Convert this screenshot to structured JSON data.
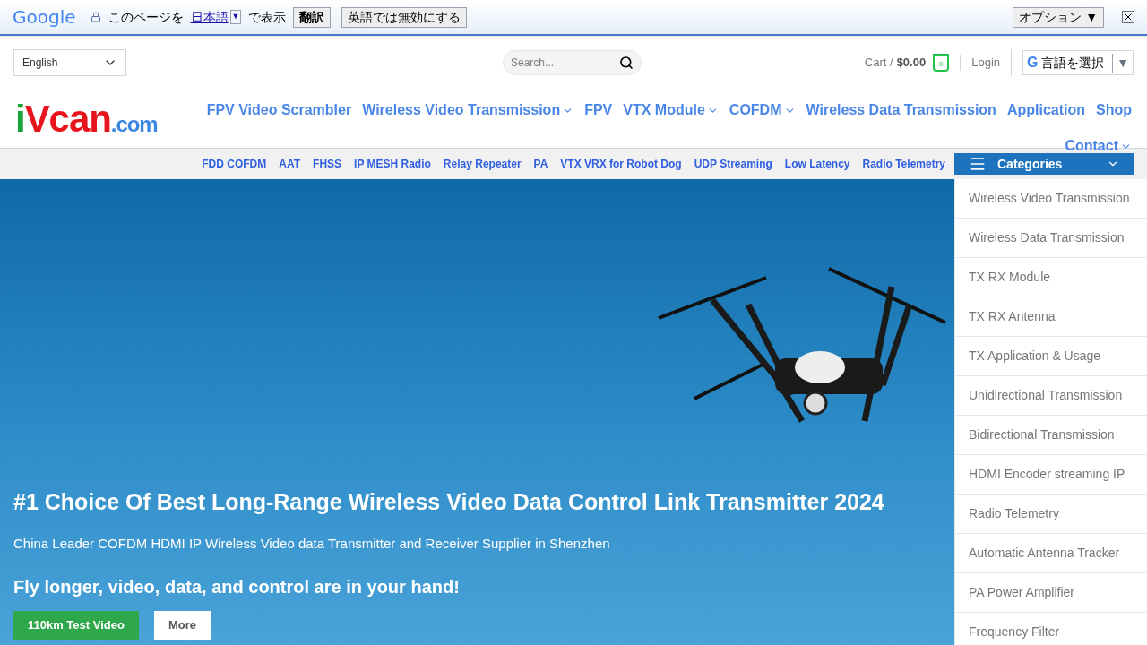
{
  "translate_bar": {
    "brand": "Google",
    "prompt": "このページを",
    "language": "日本語",
    "language_caret": "▼",
    "suffix": "で表示",
    "translate_button": "翻訳",
    "disable_button": "英語では無効にする",
    "options_button": "オプション ▼"
  },
  "header": {
    "language_select": "English",
    "search": {
      "placeholder": "Search..."
    },
    "cart_label": "Cart /",
    "cart_total": "$0.00",
    "cart_count": "0",
    "login": "Login",
    "google_mark": "G",
    "google_translate": "言語を選択",
    "google_caret": "▼"
  },
  "logo": [
    {
      "text": "i",
      "color": "#1aa33a"
    },
    {
      "text": "Vcan",
      "color": "#e8141c"
    },
    {
      "text": ".com",
      "color": "#3a86e0"
    }
  ],
  "nav": [
    {
      "label": "FPV Video Scrambler",
      "has_menu": false
    },
    {
      "label": "Wireless Video Transmission",
      "has_menu": true
    },
    {
      "label": "FPV",
      "has_menu": false
    },
    {
      "label": "VTX Module",
      "has_menu": true
    },
    {
      "label": "COFDM",
      "has_menu": true
    },
    {
      "label": "Wireless Data Transmission",
      "has_menu": false
    },
    {
      "label": "Application",
      "has_menu": false
    },
    {
      "label": "Shop",
      "has_menu": false
    },
    {
      "label": "Contact",
      "has_menu": true
    }
  ],
  "subnav": [
    "FDD COFDM",
    "AAT",
    "FHSS",
    "IP MESH Radio",
    "Relay Repeater",
    "PA",
    "VTX VRX for Robot Dog",
    "UDP Streaming",
    "Low Latency",
    "Radio Telemetry"
  ],
  "categories": {
    "title": "Categories",
    "items": [
      "Wireless Video Transmission",
      "Wireless Data Transmission",
      "TX RX Module",
      "TX RX Antenna",
      "TX Application & Usage",
      "Unidirectional Transmission",
      "Bidirectional Transmission",
      "HDMI Encoder streaming IP",
      "Radio Telemetry",
      "Automatic Antenna Tracker",
      "PA Power Amplifier",
      "Frequency Filter"
    ]
  },
  "hero": {
    "title": "#1 Choice Of Best Long-Range Wireless Video Data Control Link Transmitter 2024",
    "subtitle": "China Leader COFDM HDMI IP Wireless Video data Transmitter and Receiver Supplier in Shenzhen",
    "tagline": "Fly longer, video, data, and control are in your hand!",
    "buttons": [
      {
        "label": "110km Test Video",
        "kind": "primary"
      },
      {
        "label": "More",
        "kind": "secondary"
      }
    ]
  }
}
